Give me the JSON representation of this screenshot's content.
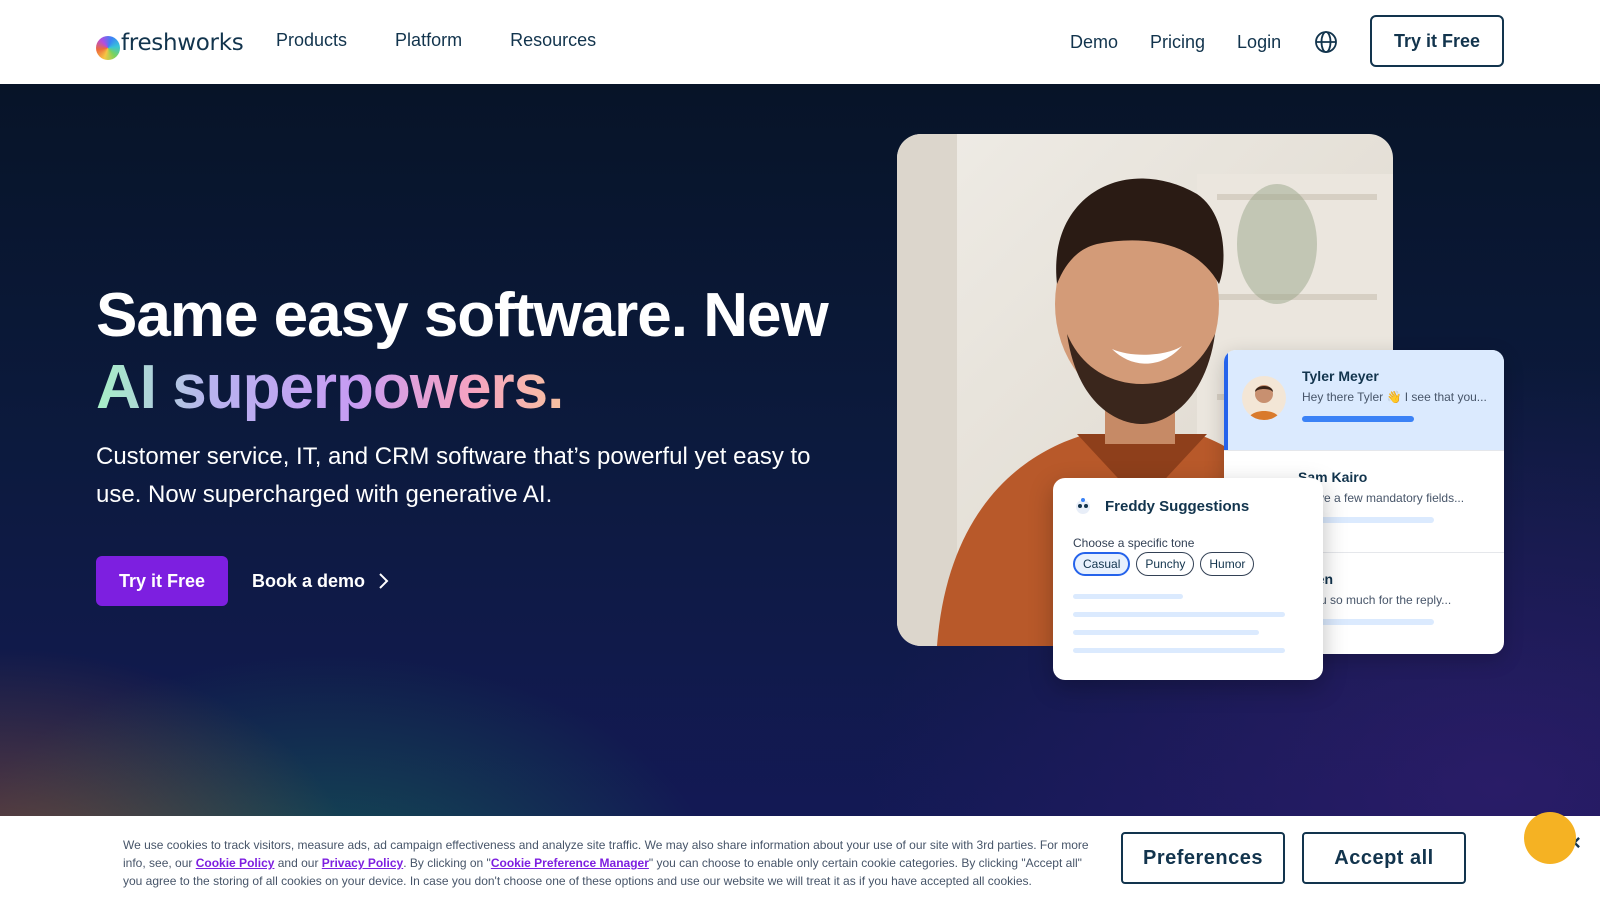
{
  "header": {
    "logo_text": "freshworks",
    "nav_left": [
      "Products",
      "Platform",
      "Resources"
    ],
    "nav_right": [
      "Demo",
      "Pricing",
      "Login"
    ],
    "globe_icon": "globe-icon",
    "try_label": "Try it Free"
  },
  "hero": {
    "title_line1": "Same easy software. New",
    "title_line2": "AI superpowers.",
    "subtitle": "Customer service, IT, and CRM software that’s powerful yet easy to use. Now supercharged with generative AI.",
    "try_label": "Try it Free",
    "demo_label": "Book a demo"
  },
  "conversations": [
    {
      "name": "Tyler Meyer",
      "message": "Hey there Tyler 👋 I see that you...",
      "active": true
    },
    {
      "name": "Sam Kairo",
      "message": "I have a few mandatory fields...",
      "active": false
    },
    {
      "name": "Chen",
      "message": "k you so much for the reply...",
      "active": false
    }
  ],
  "freddy": {
    "title": "Freddy Suggestions",
    "label": "Choose a specific tone",
    "chips": [
      "Casual",
      "Punchy",
      "Humor"
    ],
    "selected_chip": "Casual"
  },
  "cookie": {
    "text_1": "We use cookies to track visitors, measure ads, ad campaign effectiveness and analyze site traffic. We may also share information about your use of our site with 3rd parties. For more info, see, our ",
    "link_cookie_policy": "Cookie Policy",
    "text_2": " and our ",
    "link_privacy_policy": "Privacy Policy",
    "text_3": ". By clicking on \"",
    "link_pref_manager": "Cookie Preference Manager",
    "text_4": "\" you can choose to enable only certain cookie categories. By clicking \"Accept all\" you agree to the storing of all cookies on your device. In case you don't choose one of these options and use our website we will treat it as if you have accepted all cookies.",
    "preferences_label": "Preferences",
    "accept_label": "Accept all",
    "close_symbol": "×"
  },
  "colors": {
    "brand_purple": "#7d1fe0",
    "navy": "#12344d",
    "active_blue": "#2563eb"
  }
}
